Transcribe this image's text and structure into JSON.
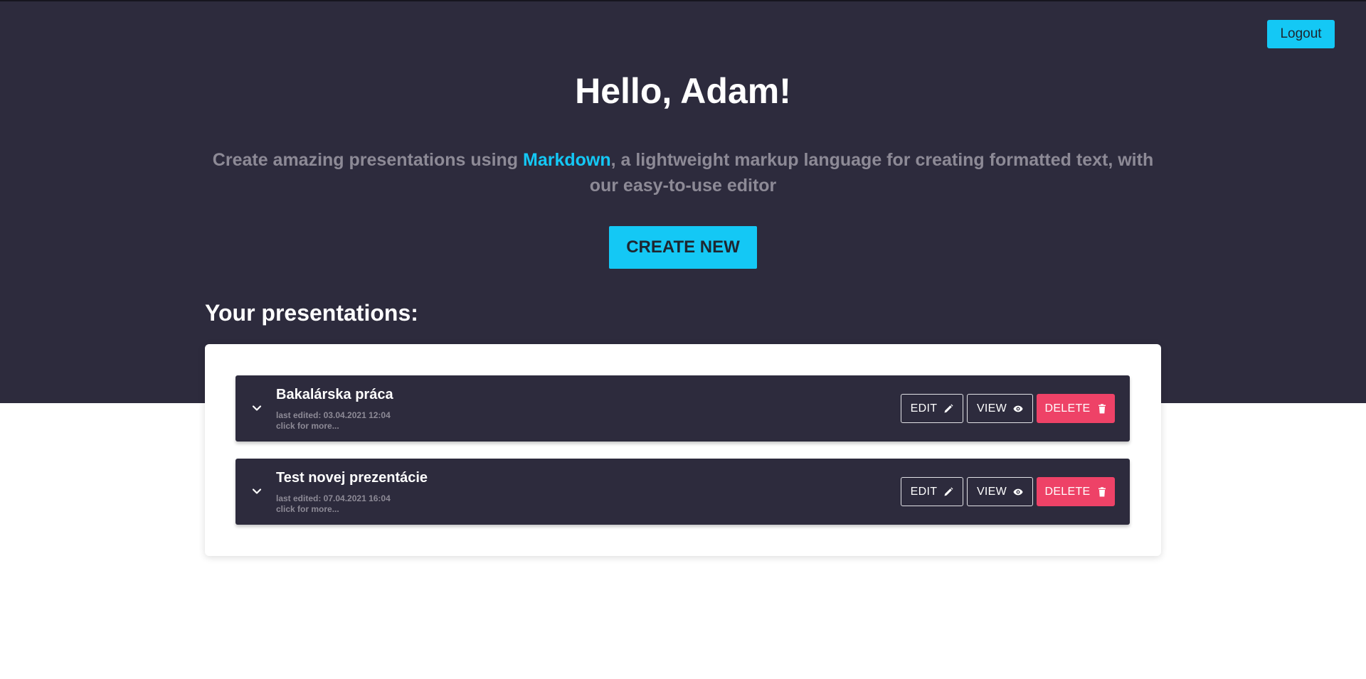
{
  "header": {
    "logout_label": "Logout",
    "greeting": "Hello, Adam!",
    "intro_before": "Create amazing presentations using ",
    "intro_link": "Markdown",
    "intro_after": ", a lightweight markup language for creating formatted text, with our easy-to-use editor",
    "create_label": "CREATE NEW"
  },
  "section_title": "Your presentations:",
  "presentations": [
    {
      "title": "Bakalárska práca",
      "last_edited": "last edited: 03.04.2021 12:04",
      "more": "click for more...",
      "edit_label": "EDIT",
      "view_label": "VIEW",
      "delete_label": "DELETE"
    },
    {
      "title": "Test novej prezentácie",
      "last_edited": "last edited: 07.04.2021 16:04",
      "more": "click for more...",
      "edit_label": "EDIT",
      "view_label": "VIEW",
      "delete_label": "DELETE"
    }
  ],
  "icons": {
    "expand": "chevron-down-icon",
    "edit": "pencil-icon",
    "view": "eye-icon",
    "delete": "trash-icon"
  },
  "colors": {
    "hero_bg": "#2d2b3d",
    "accent": "#14c8f5",
    "danger": "#ee4267",
    "muted_text": "#8d8a96"
  }
}
